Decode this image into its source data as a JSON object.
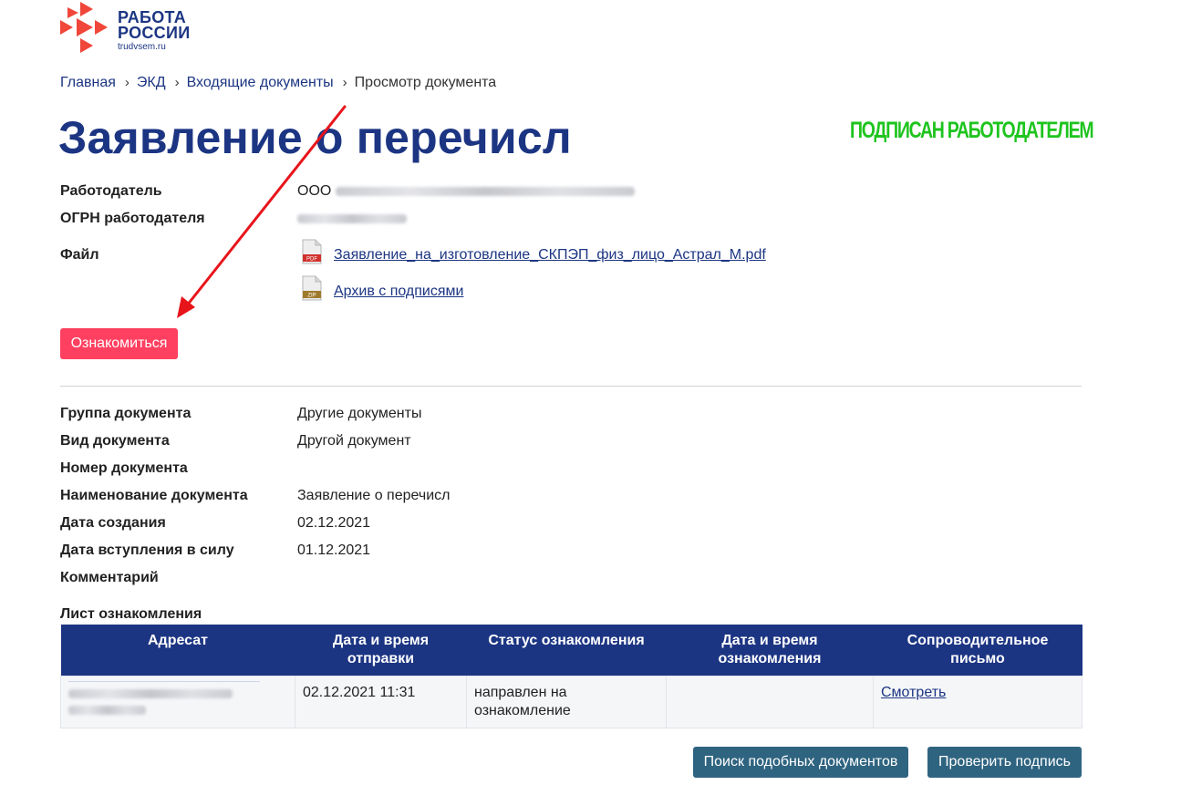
{
  "header": {
    "logo_line1": "РАБОТА",
    "logo_line2": "РОССИИ",
    "logo_domain": "trudvsem.ru",
    "logo_colors": {
      "brand_red": "#f0473a",
      "brand_blue": "#1c3583"
    }
  },
  "breadcrumb": {
    "items": [
      "Главная",
      "ЭКД",
      "Входящие документы"
    ],
    "current": "Просмотр документа",
    "separator": "›"
  },
  "document": {
    "title": "Заявление о перечисл",
    "status_stamp": "ПОДПИСАН РАБОТОДАТЕЛЕМ",
    "status_color": "#1ec41e"
  },
  "employer": {
    "employer_label": "Работодатель",
    "employer_value_prefix": "ООО",
    "ogrn_label": "ОГРН работодателя",
    "file_label": "Файл"
  },
  "files": [
    {
      "name": "Заявление_на_изготовление_СКПЭП_физ_лицо_Астрал_М.pdf",
      "icon": "pdf-file-icon",
      "badge": "PDF",
      "badge_color": "#d0312d"
    },
    {
      "name": "Архив с подписями",
      "icon": "zip-file-icon",
      "badge": "ZIP",
      "badge_color": "#a07a2c"
    }
  ],
  "actions": {
    "acknowledge_label": "Ознакомиться",
    "acknowledge_color": "#ff4060",
    "search_similar_label": "Поиск подобных документов",
    "verify_signature_label": "Проверить подпись",
    "secondary_color": "#2f6480"
  },
  "details": [
    {
      "label": "Группа документа",
      "value": "Другие документы"
    },
    {
      "label": "Вид документа",
      "value": "Другой документ"
    },
    {
      "label": "Номер документа",
      "value": ""
    },
    {
      "label": "Наименование документа",
      "value": "Заявление о перечисл"
    },
    {
      "label": "Дата создания",
      "value": "02.12.2021"
    },
    {
      "label": "Дата вступления в силу",
      "value": "01.12.2021"
    },
    {
      "label": "Комментарий",
      "value": ""
    }
  ],
  "ack_sheet": {
    "title": "Лист ознакомления",
    "columns": [
      "Адресат",
      "Дата и время отправки",
      "Статус ознакомления",
      "Дата и время ознакомления",
      "Сопроводительное письмо"
    ],
    "rows": [
      {
        "sent": "02.12.2021 11:31",
        "status": "направлен на ознакомление",
        "acknowledged": "",
        "letter_link": "Смотреть"
      }
    ],
    "header_color": "#1c3583"
  },
  "annotation": {
    "arrow_color": "#e8141b"
  }
}
